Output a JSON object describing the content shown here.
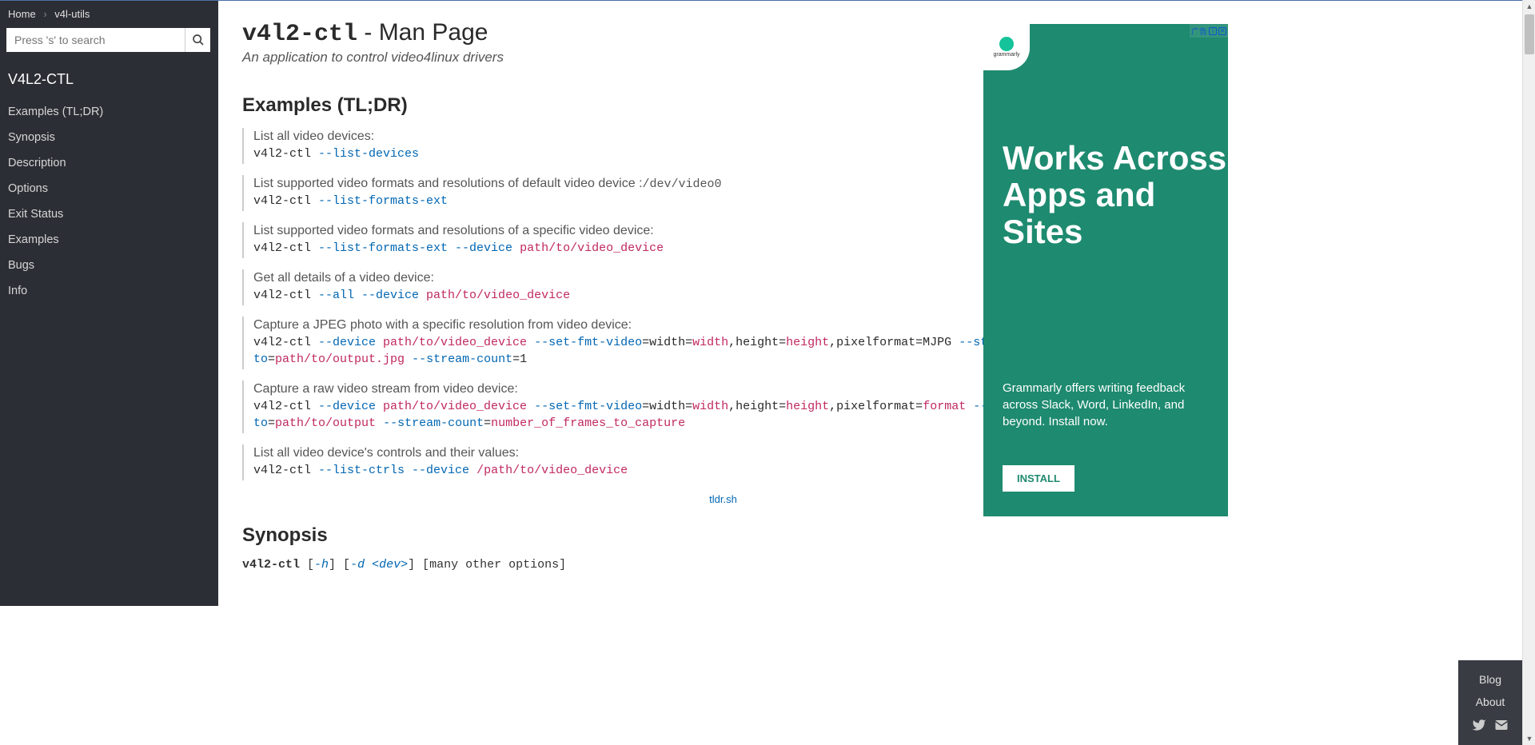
{
  "breadcrumb": {
    "home": "Home",
    "current": "v4l-utils"
  },
  "search": {
    "placeholder": "Press 's' to search"
  },
  "nav": {
    "title": "V4L2-CTL",
    "items": [
      "Examples (TL;DR)",
      "Synopsis",
      "Description",
      "Options",
      "Exit Status",
      "Examples",
      "Bugs",
      "Info"
    ]
  },
  "page": {
    "title_cmd": "v4l2-ctl",
    "title_suffix": " - Man Page",
    "subtitle": "An application to control video4linux drivers",
    "examples_heading": "Examples (TL;DR)",
    "synopsis_heading": "Synopsis",
    "source_link": "tldr.sh"
  },
  "examples": [
    {
      "desc": "List all video devices:",
      "cmd_parts": [
        [
          "",
          "v4l2-ctl "
        ],
        [
          "kw",
          "--list-devices"
        ]
      ]
    },
    {
      "desc_pre": "List supported video formats and resolutions of default video device :",
      "desc_code": "/dev/video0",
      "cmd_parts": [
        [
          "",
          "v4l2-ctl "
        ],
        [
          "kw",
          "--list-formats-ext"
        ]
      ]
    },
    {
      "desc": "List supported video formats and resolutions of a specific video device:",
      "cmd_parts": [
        [
          "",
          "v4l2-ctl "
        ],
        [
          "kw",
          "--list-formats-ext --device "
        ],
        [
          "arg",
          "path/to/video_device"
        ]
      ]
    },
    {
      "desc": "Get all details of a video device:",
      "cmd_parts": [
        [
          "",
          "v4l2-ctl "
        ],
        [
          "kw",
          "--all --device "
        ],
        [
          "arg",
          "path/to/video_device"
        ]
      ]
    },
    {
      "desc": "Capture a JPEG photo with a specific resolution from video device:",
      "cmd_parts": [
        [
          "",
          "v4l2-ctl "
        ],
        [
          "kw",
          "--device "
        ],
        [
          "arg",
          "path/to/video_device"
        ],
        [
          "kw",
          " --set-fmt-video"
        ],
        [
          "",
          "=width="
        ],
        [
          "arg",
          "width"
        ],
        [
          "",
          ",height="
        ],
        [
          "arg",
          "height"
        ],
        [
          "",
          ",pixelformat=MJPG "
        ],
        [
          "kw",
          "--stream-mmap --stream-to"
        ],
        [
          "",
          "="
        ],
        [
          "arg",
          "path/to/output.jpg"
        ],
        [
          "kw",
          " --stream-count"
        ],
        [
          "",
          "=1"
        ]
      ]
    },
    {
      "desc": "Capture a raw video stream from video device:",
      "cmd_parts": [
        [
          "",
          "v4l2-ctl "
        ],
        [
          "kw",
          "--device "
        ],
        [
          "arg",
          "path/to/video_device"
        ],
        [
          "kw",
          " --set-fmt-video"
        ],
        [
          "",
          "=width="
        ],
        [
          "arg",
          "width"
        ],
        [
          "",
          ",height="
        ],
        [
          "arg",
          "height"
        ],
        [
          "",
          ",pixelformat="
        ],
        [
          "arg",
          "format"
        ],
        [
          "kw",
          " --stream-mmap --stream-to"
        ],
        [
          "",
          "="
        ],
        [
          "arg",
          "path/to/output"
        ],
        [
          "kw",
          " --stream-count"
        ],
        [
          "",
          "="
        ],
        [
          "arg",
          "number_of_frames_to_capture"
        ]
      ]
    },
    {
      "desc": "List all video device's controls and their values:",
      "cmd_parts": [
        [
          "",
          "v4l2-ctl "
        ],
        [
          "kw",
          "--list-ctrls --device "
        ],
        [
          "arg",
          "/path/to/video_device"
        ]
      ]
    }
  ],
  "synopsis": {
    "cmd": "v4l2-ctl",
    "parts": [
      [
        "opt",
        "-h"
      ],
      [
        "",
        "] ["
      ],
      [
        "opt",
        "-d <dev>"
      ],
      [
        "",
        "] [many other options]"
      ]
    ]
  },
  "ad": {
    "badge": "广告",
    "logo_text": "grammarly",
    "heading": "Works Across Apps and Sites",
    "copy": "Grammarly offers writing feedback across Slack, Word, LinkedIn, and beyond. Install now.",
    "button": "INSTALL"
  },
  "footer": {
    "blog": "Blog",
    "about": "About"
  }
}
